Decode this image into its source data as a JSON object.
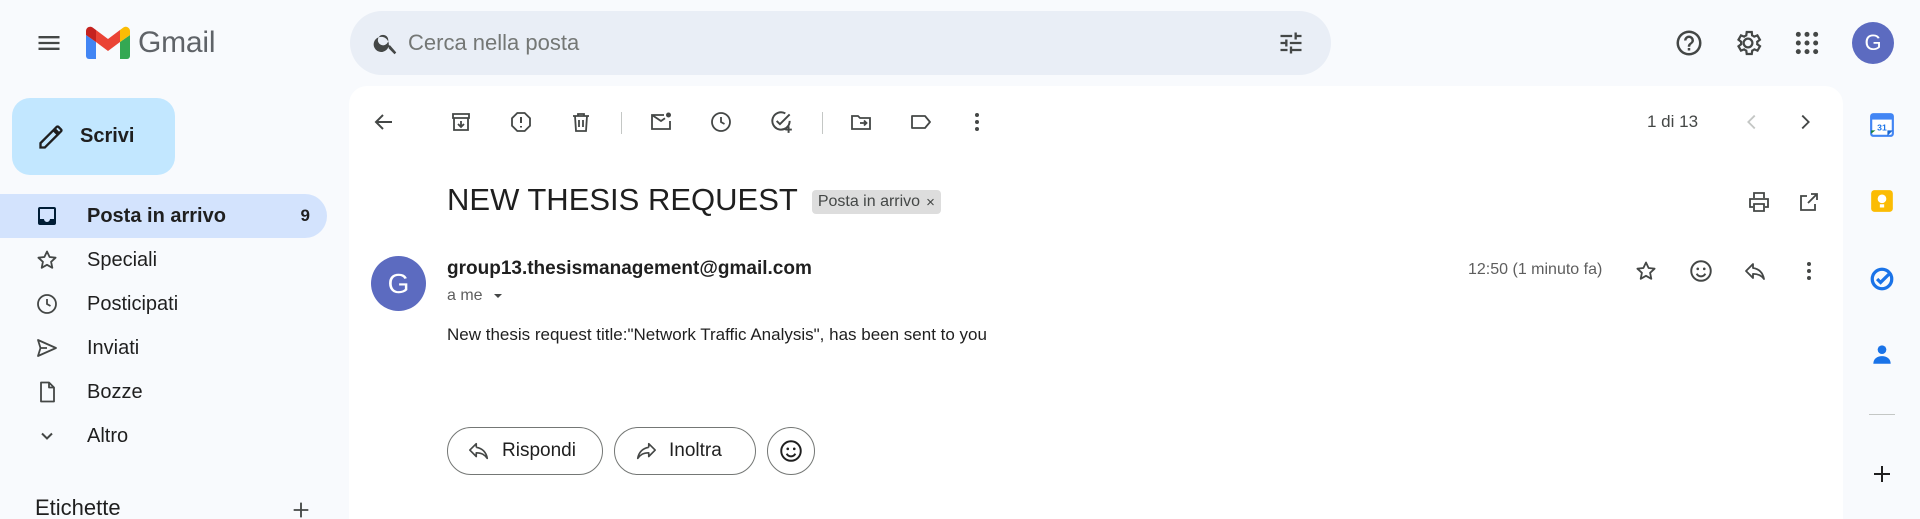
{
  "app": {
    "name": "Gmail"
  },
  "search": {
    "placeholder": "Cerca nella posta"
  },
  "user": {
    "avatar_letter": "G",
    "avatar_color": "#5c6bc0"
  },
  "compose": {
    "label": "Scrivi"
  },
  "sidebar": {
    "items": [
      {
        "label": "Posta in arrivo",
        "count": "9",
        "icon": "inbox-icon",
        "active": true
      },
      {
        "label": "Speciali",
        "icon": "star-icon"
      },
      {
        "label": "Posticipati",
        "icon": "clock-icon"
      },
      {
        "label": "Inviati",
        "icon": "send-icon"
      },
      {
        "label": "Bozze",
        "icon": "draft-icon"
      },
      {
        "label": "Altro",
        "icon": "chevron-down-icon"
      }
    ],
    "labels_heading": "Etichette"
  },
  "toolbar": {
    "pager": "1 di 13"
  },
  "message": {
    "subject": "NEW THESIS REQUEST",
    "label_tag": "Posta in arrivo",
    "label_tag_close": "×",
    "sender_letter": "G",
    "sender_email": "group13.thesismanagement@gmail.com",
    "recipient": "a me",
    "time": "12:50 (1 minuto fa)",
    "body": "New thesis request title:\"Network Traffic Analysis\", has been sent to you"
  },
  "actions": {
    "reply": "Rispondi",
    "forward": "Inoltra"
  },
  "colors": {
    "accent": "#c2e7ff",
    "active_nav": "#d3e3fd",
    "background": "#f8fafd"
  }
}
